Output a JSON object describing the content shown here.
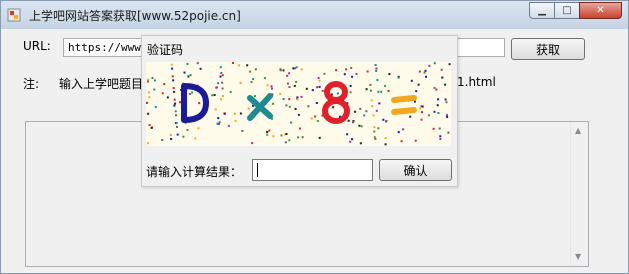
{
  "window": {
    "title": "上学吧网站答案获取[www.52pojie.cn]"
  },
  "main": {
    "url_label": "URL:",
    "url_value": "https://www.s",
    "fetch_button": "获取",
    "note_label": "注:",
    "note_text_visible": "输入上学吧题目",
    "note_text_tail": "1.html"
  },
  "captcha_dialog": {
    "title": "验证码",
    "captcha_chars": [
      "D",
      "×",
      "8",
      "="
    ],
    "captcha_colors": [
      "#1b1b9a",
      "#1f8a8f",
      "#e0202a",
      "#f0a81e"
    ],
    "prompt": "请输入计算结果：",
    "answer_value": "",
    "confirm_button": "确认"
  },
  "icons": [
    "app-icon",
    "minimize-icon",
    "maximize-icon",
    "close-icon",
    "scroll-up-icon",
    "scroll-down-icon"
  ]
}
